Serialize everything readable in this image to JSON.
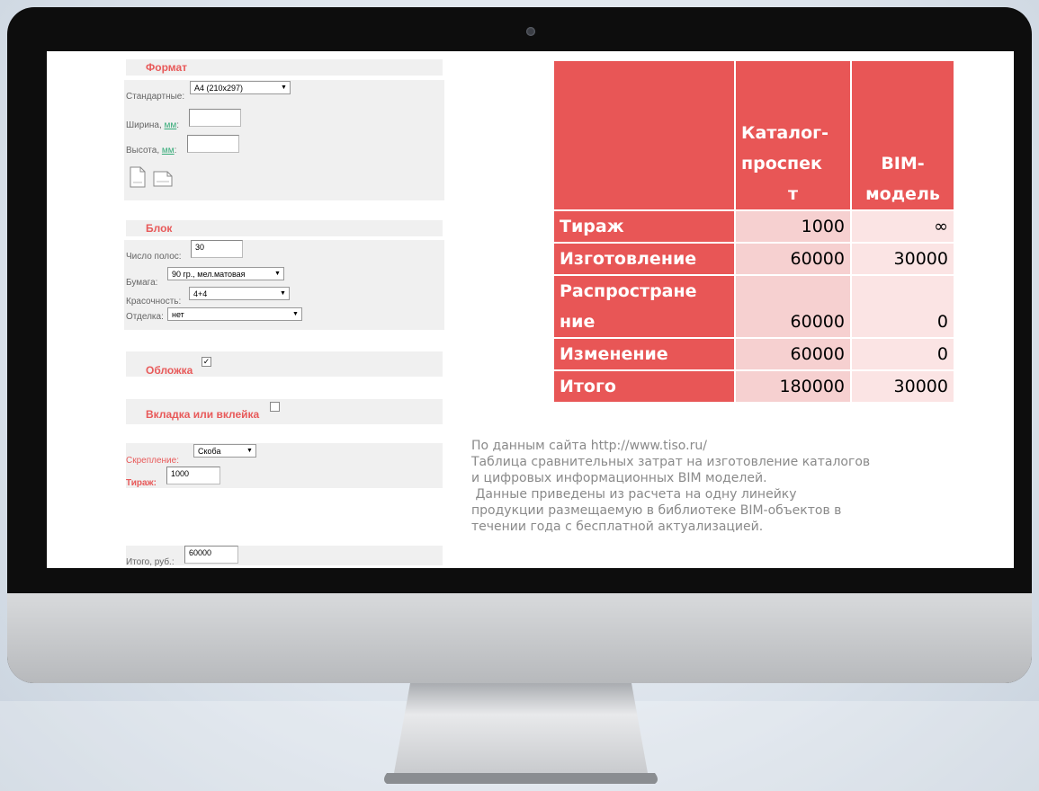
{
  "form": {
    "format": {
      "title": "Формат",
      "standard_label": "Стандартные:",
      "standard_value": "А4 (210х297)",
      "width_label": "Ширина,",
      "height_label": "Высота,",
      "unit": "мм",
      "width_value": "",
      "height_value": ""
    },
    "block": {
      "title": "Блок",
      "pages_label": "Число полос:",
      "pages_value": "30",
      "paper_label": "Бумага:",
      "paper_value": "90 гр., мел.матовая",
      "color_label": "Красочность:",
      "color_value": "4+4",
      "finish_label": "Отделка:",
      "finish_value": "нет"
    },
    "cover": {
      "title": "Обложка",
      "checked": "✓"
    },
    "insert": {
      "title": "Вкладка или вклейка"
    },
    "binding_label": "Скрепление:",
    "binding_value": "Скоба",
    "run_label": "Тираж:",
    "run_value": "1000",
    "total_label": "Итого, руб.:",
    "total_value": "60000"
  },
  "table": {
    "headers": {
      "col1_line1": "Каталог-",
      "col1_line2": "проспек",
      "col1_line3": "т",
      "col2_line1": "BIM-",
      "col2_line2": "модель"
    },
    "rows": [
      {
        "label": "Тираж",
        "catalog": "1000",
        "bim": "∞"
      },
      {
        "label": "Изготовление",
        "catalog": "60000",
        "bim": "30000"
      },
      {
        "label_line1": "Распростране",
        "label_line2": "ние",
        "catalog": "60000",
        "bim": "0"
      },
      {
        "label": "Изменение",
        "catalog": "60000",
        "bim": "0"
      },
      {
        "label": "Итого",
        "catalog": "180000",
        "bim": "30000"
      }
    ]
  },
  "note": [
    "По данным сайта http://www.tiso.ru/",
    "Таблица сравнительных затрат на изготовление каталогов",
    "и цифровых информационных BIM моделей.",
    " Данные приведены из расчета на одну линейку",
    "продукции размещаемую в библиотеке BIM-объектов в",
    "течении года с бесплатной актуализацией."
  ],
  "colors": {
    "accent": "#e85656",
    "cell_light": "#f6d0d0",
    "note_text": "#8a8a8a"
  }
}
